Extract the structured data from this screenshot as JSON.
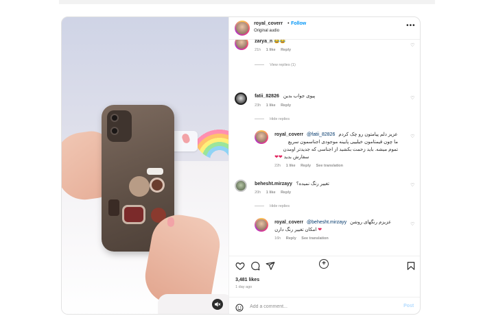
{
  "post": {
    "username": "royal_coverr",
    "separator": "•",
    "follow_label": "Follow",
    "audio": "Original audio",
    "more_icon": "more-horizontal-icon"
  },
  "comments": [
    {
      "username": "zarya_n",
      "text": "😂😂",
      "time": "21h",
      "likes": "1 like",
      "reply_label": "Reply",
      "view_replies": "View replies (1)"
    },
    {
      "username": "fatii_82826",
      "text": "پیوی جواب بدین",
      "time": "23h",
      "likes": "1 like",
      "reply_label": "Reply",
      "view_replies": "Hide replies",
      "replies": [
        {
          "username": "royal_coverr",
          "mention": "@fatii_82826",
          "line1": "عزیز دلم پیامتون رو چک کردم",
          "line2": "ما چون قیمتامون خیلییی پایینه موجودی اجناسمون سریع",
          "line3": "تموم میشه. باید زحمت بکشید از اجناسی که جدیدتر اومدن",
          "line4": "سفارش بدید",
          "time": "22h",
          "likes": "1 like",
          "reply_label": "Reply",
          "translate": "See translation"
        }
      ]
    },
    {
      "username": "behesht.mirzayy",
      "text": "تغییر رنگ نمیده؟",
      "time": "20h",
      "likes": "1 like",
      "reply_label": "Reply",
      "view_replies": "Hide replies",
      "replies": [
        {
          "username": "royal_coverr",
          "mention": "@behesht.mirzayy",
          "line1": "عزیزم رنگهای روشن",
          "line2": "امکان تغییر رنگ دارن",
          "time": "16h",
          "reply_label": "Reply",
          "translate": "See translation"
        }
      ]
    }
  ],
  "actions": {
    "like_icon": "heart-icon",
    "comment_icon": "comment-icon",
    "share_icon": "send-icon",
    "save_icon": "bookmark-icon",
    "likes": "3,481 likes",
    "time_ago": "1 day ago"
  },
  "add_comment": {
    "placeholder": "Add a comment...",
    "post_label": "Post",
    "emoji_icon": "smiley-icon"
  },
  "media": {
    "mute_icon": "speaker-muted-icon"
  }
}
